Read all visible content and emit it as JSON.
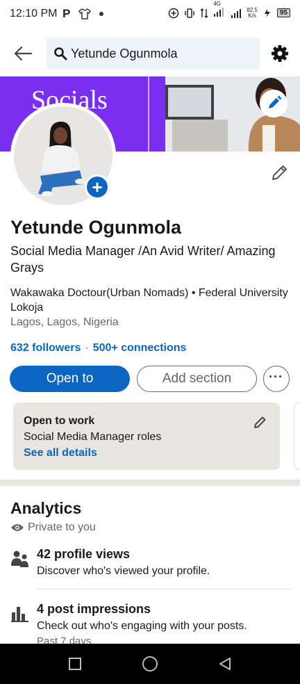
{
  "status_bar": {
    "time": "12:10 PM",
    "p_icon": "P",
    "network_label": "4G",
    "speed_value": "82.5",
    "speed_unit": "K/s",
    "battery": "95"
  },
  "top_bar": {
    "search_value": "Yetunde Ogunmola"
  },
  "banner": {
    "text": "Socials",
    "left_color": "#7a2ff0"
  },
  "profile": {
    "name": "Yetunde Ogunmola",
    "headline": "Social Media Manager /An Avid Writer/ Amazing Grays",
    "education": "Wakawaka Doctour(Urban Nomads) • Federal University Lokoja",
    "location": "Lagos, Lagos, Nigeria",
    "followers": "632 followers",
    "separator": "·",
    "connections": "500+ connections"
  },
  "actions": {
    "open_to": "Open to",
    "add_section": "Add section",
    "more": "···"
  },
  "open_to_work": {
    "title": "Open to work",
    "roles": "Social Media Manager roles",
    "link": "See all details"
  },
  "analytics": {
    "title": "Analytics",
    "visibility": "Private to you",
    "items": [
      {
        "icon": "people-icon",
        "title": "42 profile views",
        "subtitle": "Discover who's viewed your profile."
      },
      {
        "icon": "bar-chart-icon",
        "title": "4 post impressions",
        "subtitle": "Check out who's engaging with your posts.",
        "extra": "Past 7 days"
      }
    ]
  },
  "colors": {
    "accent": "#0a66c2",
    "card_bg": "#e9e5df"
  }
}
